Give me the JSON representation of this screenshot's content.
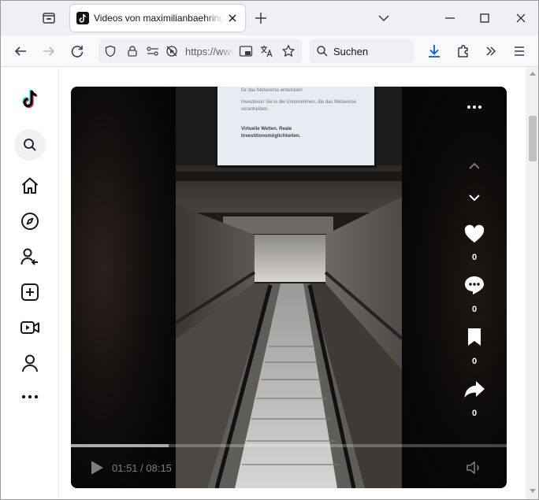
{
  "browser": {
    "tab": {
      "title": "Videos von maximilianbaehring"
    },
    "url": "https://www",
    "search_placeholder": "Suchen"
  },
  "player": {
    "time_current": "01:51",
    "time_total": "08:15",
    "time_display": "01:51 / 08:15",
    "progress": 0.225,
    "likes": "0",
    "comments": "0",
    "saves": "0",
    "shares": "0",
    "video_poster": {
      "line1": "für das Metaverse entwickeln.",
      "line2": "Investieren Sie in die Unternehmen, die das Metaverse vorantreiben.",
      "line3": "Virtuelle Welten. Reale Investitionsmöglichkeiten.",
      "line4": ""
    }
  },
  "sidebar": {
    "items": [
      "tiktok-logo",
      "search-icon",
      "home-icon",
      "explore-icon",
      "following-icon",
      "upload-icon",
      "live-icon",
      "profile-icon",
      "more-icon"
    ]
  },
  "colors": {
    "accent_blue": "#0060df",
    "tiktok_cyan": "#25f4ee",
    "tiktok_red": "#fe2c55"
  }
}
